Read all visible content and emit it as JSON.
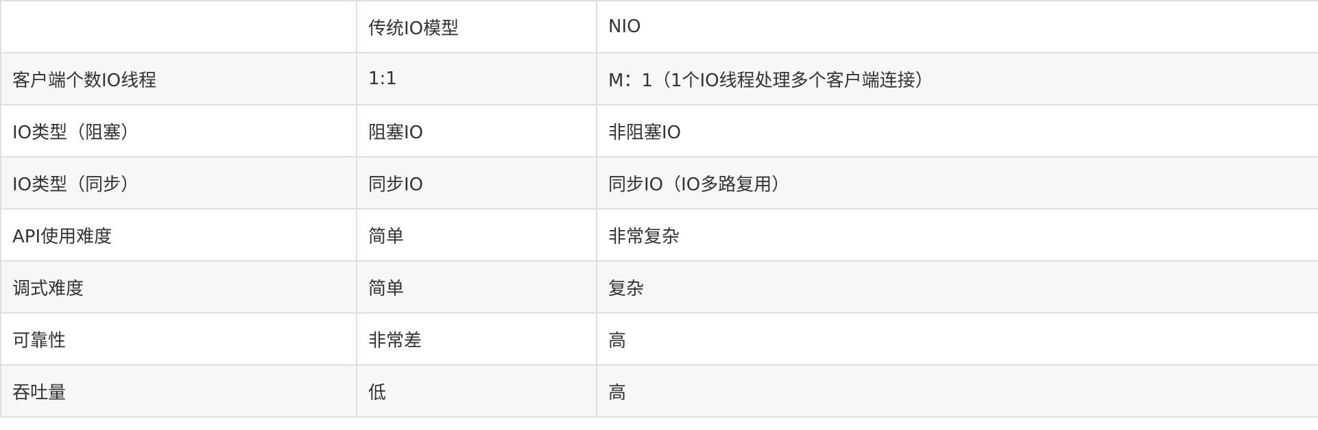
{
  "table": {
    "headers": [
      "",
      "传统IO模型",
      "NIO"
    ],
    "rows": [
      [
        "客户端个数IO线程",
        "1:1",
        "M：1（1个IO线程处理多个客户端连接）"
      ],
      [
        "IO类型（阻塞）",
        "阻塞IO",
        "非阻塞IO"
      ],
      [
        "IO类型（同步）",
        "同步IO",
        "同步IO（IO多路复用）"
      ],
      [
        "API使用难度",
        "简单",
        "非常复杂"
      ],
      [
        "调式难度",
        "简单",
        "复杂"
      ],
      [
        "可靠性",
        "非常差",
        "高"
      ],
      [
        "吞吐量",
        "低",
        "高"
      ]
    ]
  },
  "colors": {
    "border": "#dfdfdf",
    "stripe": "#f7f7f7",
    "text": "#333333"
  }
}
